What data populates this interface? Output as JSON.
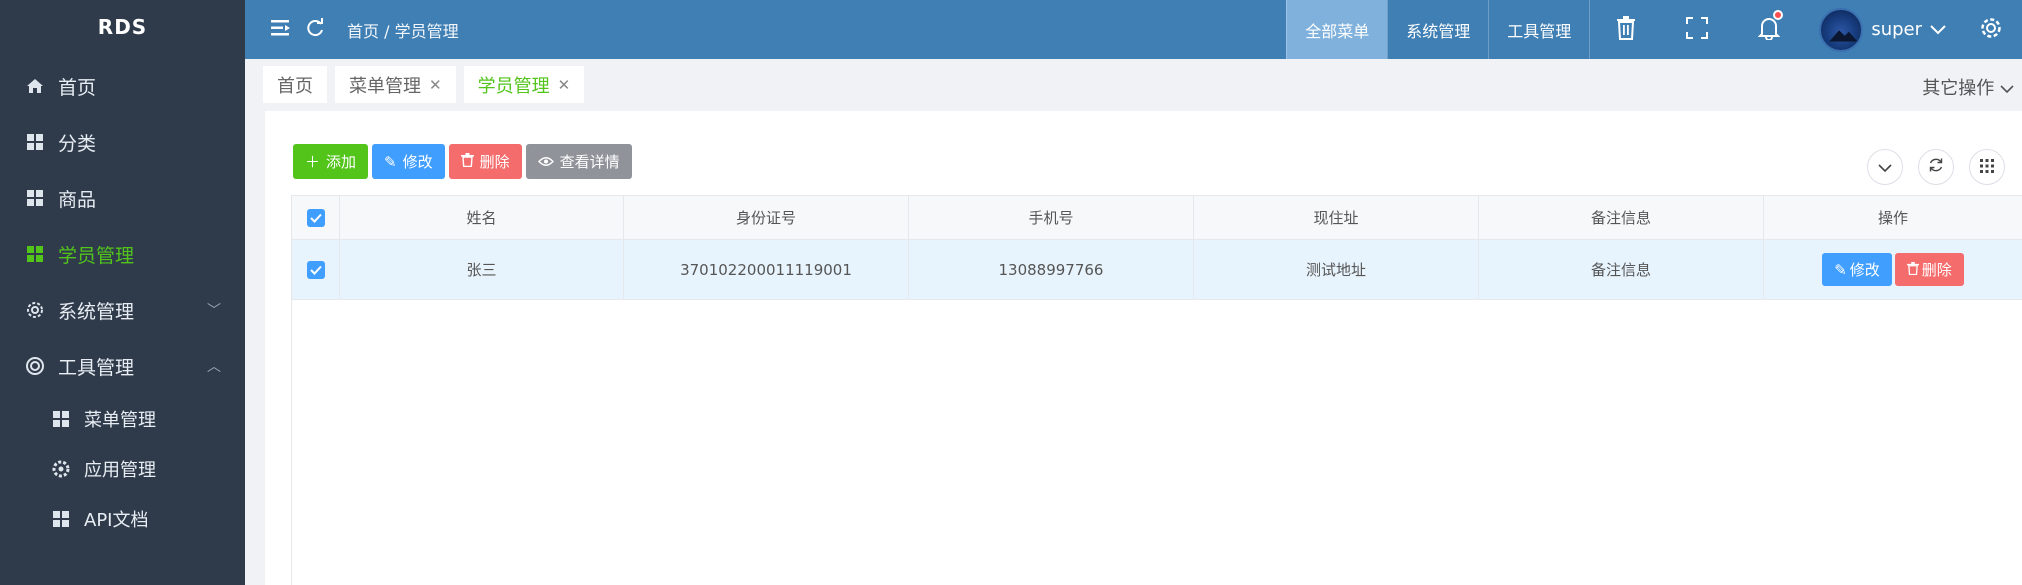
{
  "sidebar": {
    "brand": "RDS",
    "items": [
      {
        "label": "首页",
        "icon": "home-icon"
      },
      {
        "label": "分类",
        "icon": "grid-icon"
      },
      {
        "label": "商品",
        "icon": "grid-icon"
      },
      {
        "label": "学员管理",
        "icon": "grid-icon",
        "active": true
      },
      {
        "label": "系统管理",
        "icon": "gear-icon",
        "expanded": false
      },
      {
        "label": "工具管理",
        "icon": "lifebuoy-icon",
        "expanded": true
      }
    ],
    "subitems": [
      {
        "label": "菜单管理",
        "icon": "grid-icon"
      },
      {
        "label": "应用管理",
        "icon": "gear-icon"
      },
      {
        "label": "API文档",
        "icon": "grid-icon"
      }
    ]
  },
  "header": {
    "breadcrumb": "首页 / 学员管理",
    "nav": [
      "全部菜单",
      "系统管理",
      "工具管理"
    ],
    "active_nav": "全部菜单",
    "user": "super"
  },
  "tabs": {
    "items": [
      "首页",
      "菜单管理",
      "学员管理"
    ],
    "other_ops": "其它操作"
  },
  "toolbar": {
    "add": "添加",
    "edit": "修改",
    "delete": "删除",
    "detail": "查看详情"
  },
  "table": {
    "columns": [
      "姓名",
      "身份证号",
      "手机号",
      "现住址",
      "备注信息",
      "操作"
    ],
    "rows": [
      {
        "name": "张三",
        "id_number": "370102200011119001",
        "phone": "13088997766",
        "address": "测试地址",
        "note": "备注信息",
        "edit": "修改",
        "delete": "删除"
      }
    ]
  },
  "colors": {
    "sidebar_bg": "#2f3b4b",
    "header_bg": "#3f7fb4",
    "accent_green": "#52c41a",
    "primary_blue": "#409eff",
    "danger_red": "#f56c6c"
  }
}
